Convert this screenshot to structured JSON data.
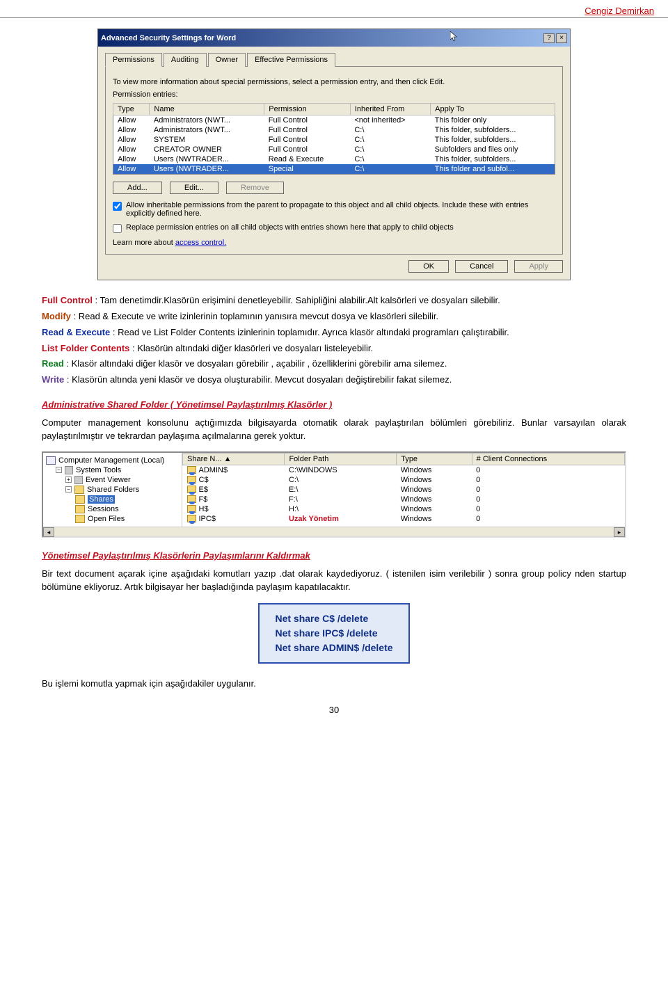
{
  "header": {
    "author": "Cengiz Demirkan"
  },
  "dialog": {
    "title": "Advanced Security Settings for Word",
    "help_btn": "?",
    "close_btn": "×",
    "tabs": [
      "Permissions",
      "Auditing",
      "Owner",
      "Effective Permissions"
    ],
    "intro": "To view more information about special permissions, select a permission entry, and then click Edit.",
    "entries_label": "Permission entries:",
    "columns": [
      "Type",
      "Name",
      "Permission",
      "Inherited From",
      "Apply To"
    ],
    "rows": [
      {
        "type": "Allow",
        "name": "Administrators (NWT...",
        "perm": "Full Control",
        "inh": "<not inherited>",
        "apply": "This folder only"
      },
      {
        "type": "Allow",
        "name": "Administrators (NWT...",
        "perm": "Full Control",
        "inh": "C:\\",
        "apply": "This folder, subfolders..."
      },
      {
        "type": "Allow",
        "name": "SYSTEM",
        "perm": "Full Control",
        "inh": "C:\\",
        "apply": "This folder, subfolders..."
      },
      {
        "type": "Allow",
        "name": "CREATOR OWNER",
        "perm": "Full Control",
        "inh": "C:\\",
        "apply": "Subfolders and files only"
      },
      {
        "type": "Allow",
        "name": "Users (NWTRADER...",
        "perm": "Read & Execute",
        "inh": "C:\\",
        "apply": "This folder, subfolders..."
      },
      {
        "type": "Allow",
        "name": "Users (NWTRADER...",
        "perm": "Special",
        "inh": "C:\\",
        "apply": "This folder and subfol...",
        "selected": true
      }
    ],
    "buttons": {
      "add": "Add...",
      "edit": "Edit...",
      "remove": "Remove"
    },
    "chk1": "Allow inheritable permissions from the parent to propagate to this object and all child objects. Include these with entries explicitly defined here.",
    "chk2": "Replace permission entries on all child objects with entries shown here that apply to child objects",
    "learn_prefix": "Learn more about ",
    "learn_link": "access control.",
    "bottom": {
      "ok": "OK",
      "cancel": "Cancel",
      "apply": "Apply"
    }
  },
  "perm_desc": {
    "fc": {
      "term": "Full Control",
      "text": " : Tam denetimdir.Klasörün erişimini denetleyebilir. Sahipliğini alabilir.Alt kalsörleri ve dosyaları silebilir."
    },
    "mod": {
      "term": "Modify",
      "text": " : Read & Execute ve write izinlerinin toplamının yanısıra mevcut dosya ve klasörleri silebilir."
    },
    "rxe": {
      "term": "Read & Execute",
      "text": " : Read ve List Folder Contents izinlerinin toplamıdır. Ayrıca klasör altındaki programları çalıştırabilir."
    },
    "lfc": {
      "term": "List  Folder Contents",
      "text": " : Klasörün altındaki diğer klasörleri ve dosyaları listeleyebilir."
    },
    "rd": {
      "term": "Read",
      "text": " : Klasör altındaki diğer klasör ve dosyaları görebilir , açabilir , özelliklerini görebilir ama silemez."
    },
    "wr": {
      "term": "Write",
      "text": " : Klasörün altında yeni klasör ve dosya oluşturabilir. Mevcut dosyaları değiştirebilir fakat silemez."
    }
  },
  "admin_heading": "Administrative Shared Folder ( Yönetimsel Paylaştırılmış Klasörler )",
  "admin_para": "Computer management konsolunu açtığımızda bilgisayarda otomatik olarak paylaştırılan bölümleri görebiliriz. Bunlar varsayılan olarak paylaştırılmıştır ve tekrardan paylaşıma açılmalarına gerek yoktur.",
  "cm": {
    "tree": {
      "root": "Computer Management (Local)",
      "sys": "System Tools",
      "ev": "Event Viewer",
      "sf": "Shared Folders",
      "shares": "Shares",
      "sessions": "Sessions",
      "open": "Open Files"
    },
    "columns": [
      "Share N...   ▲",
      "Folder Path",
      "Type",
      "# Client Connections"
    ],
    "rows": [
      {
        "name": "ADMIN$",
        "path": "C:\\WINDOWS",
        "type": "Windows",
        "conn": "0"
      },
      {
        "name": "C$",
        "path": "C:\\",
        "type": "Windows",
        "conn": "0"
      },
      {
        "name": "E$",
        "path": "E:\\",
        "type": "Windows",
        "conn": "0"
      },
      {
        "name": "F$",
        "path": "F:\\",
        "type": "Windows",
        "conn": "0"
      },
      {
        "name": "H$",
        "path": "H:\\",
        "type": "Windows",
        "conn": "0"
      },
      {
        "name": "IPC$",
        "path": "Uzak Yönetim",
        "type": "Windows",
        "conn": "0",
        "overlay": true
      }
    ]
  },
  "remove_heading": "Yönetimsel Paylaştırılmış Klasörlerin Paylaşımlarını Kaldırmak",
  "remove_para": "Bir text document açarak içine aşağıdaki komutları yazıp .dat olarak kaydediyoruz. ( istenilen isim verilebilir ) sonra group policy nden startup bölümüne ekliyoruz. Artık bilgisayar her başladığında paylaşım kapatılacaktır.",
  "cmd": {
    "l1": "Net share C$ /delete",
    "l2": "Net share IPC$ /delete",
    "l3": "Net share ADMIN$ /delete"
  },
  "cmd_follow": "Bu işlemi komutla yapmak için aşağıdakiler uygulanır.",
  "page_num": "30"
}
